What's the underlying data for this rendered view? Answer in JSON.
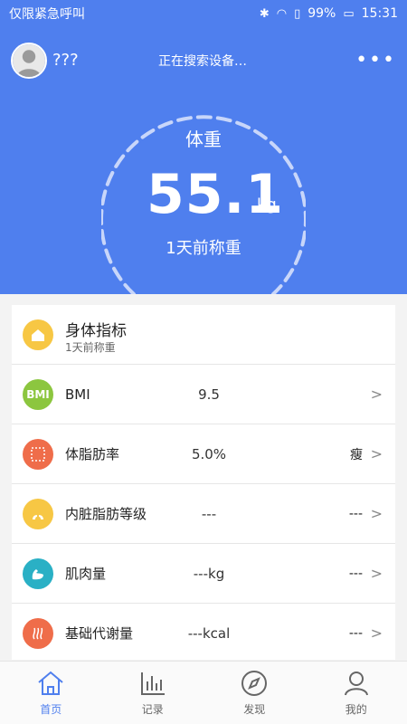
{
  "status_bar": {
    "left_text": "仅限紧急呼叫",
    "battery": "99%",
    "time": "15:31"
  },
  "header": {
    "username": "???",
    "search_status": "正在搜索设备…",
    "more_label": "•••",
    "weight_label": "体重",
    "weight_value": "55.1",
    "weight_unit": "kg",
    "weight_sub": "1天前称重"
  },
  "metrics": {
    "title": "身体指标",
    "subtitle": "1天前称重",
    "rows": [
      {
        "name": "BMI",
        "value": "9.5",
        "status": "",
        "icon_text": "BMI",
        "icon": "bmi-icon",
        "color": "#8cc63f"
      },
      {
        "name": "体脂肪率",
        "value": "5.0%",
        "status": "瘦",
        "icon_text": "",
        "icon": "body-fat-icon",
        "color": "#ef6d4a"
      },
      {
        "name": "内脏脂肪等级",
        "value": "---",
        "status": "---",
        "icon_text": "",
        "icon": "visceral-fat-icon",
        "color": "#f7c744"
      },
      {
        "name": "肌肉量",
        "value": "---kg",
        "status": "---",
        "icon_text": "",
        "icon": "muscle-icon",
        "color": "#2ab0c5"
      },
      {
        "name": "基础代谢量",
        "value": "---kcal",
        "status": "---",
        "icon_text": "",
        "icon": "metabolism-icon",
        "color": "#ef6d4a"
      }
    ],
    "chevron": ">"
  },
  "nav": {
    "tabs": [
      {
        "label": "首页",
        "active": true
      },
      {
        "label": "记录",
        "active": false
      },
      {
        "label": "发现",
        "active": false
      },
      {
        "label": "我的",
        "active": false
      }
    ]
  },
  "colors": {
    "primary": "#4f7fee",
    "header_bg": "#4f7fee",
    "card_bg": "#ffffff"
  }
}
